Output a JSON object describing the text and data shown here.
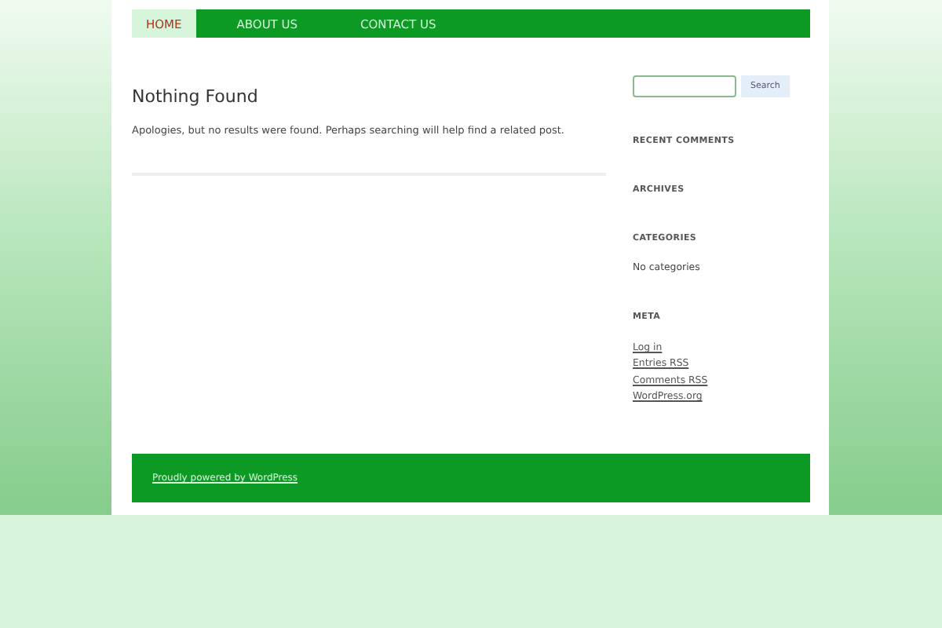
{
  "nav": {
    "items": [
      {
        "label": "HOME",
        "selected": true
      },
      {
        "label": "ABOUT US",
        "selected": false
      },
      {
        "label": "CONTACT US",
        "selected": false
      }
    ]
  },
  "content": {
    "title": "Nothing Found",
    "message": "Apologies, but no results were found. Perhaps searching will help find a related post."
  },
  "sidebar": {
    "search": {
      "button": "Search"
    },
    "widgets": [
      {
        "title": "RECENT COMMENTS"
      },
      {
        "title": "ARCHIVES"
      },
      {
        "title": "CATEGORIES",
        "text": "No categories"
      },
      {
        "title": "META",
        "links": [
          "Log in",
          "Entries RSS",
          "Comments RSS",
          "WordPress.org"
        ]
      }
    ]
  },
  "footer": {
    "link": "Proudly powered by WordPress"
  }
}
